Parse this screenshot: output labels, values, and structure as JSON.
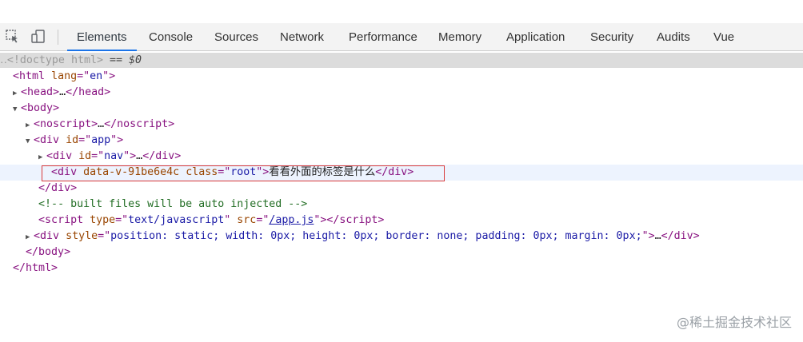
{
  "toolbar": {
    "tabs": [
      "Elements",
      "Console",
      "Sources",
      "Network",
      "Performance",
      "Memory",
      "Application",
      "Security",
      "Audits",
      "Vue"
    ],
    "active_tab": "Elements"
  },
  "dom": {
    "doctype": "<!doctype html>",
    "selected_marker": "== $0",
    "html_open": "<html",
    "html_lang_attr": "lang",
    "html_lang_val": "en",
    "head_open": "<head>",
    "head_close": "</head>",
    "body_open": "<body>",
    "noscript_open": "<noscript>",
    "noscript_close": "</noscript>",
    "div_app_id": "app",
    "div_nav_id": "nav",
    "root_data_attr": "data-v-91be6e4c",
    "root_class": "root",
    "root_text": "看看外面的标签是什么",
    "comment": "<!-- built files will be auto injected -->",
    "script_type": "text/javascript",
    "script_src": "/app.js",
    "div_style": "position: static; width: 0px; height: 0px; border: none; padding: 0px; margin: 0px;",
    "ellipsis": "…"
  },
  "watermark": "@稀土掘金技术社区"
}
